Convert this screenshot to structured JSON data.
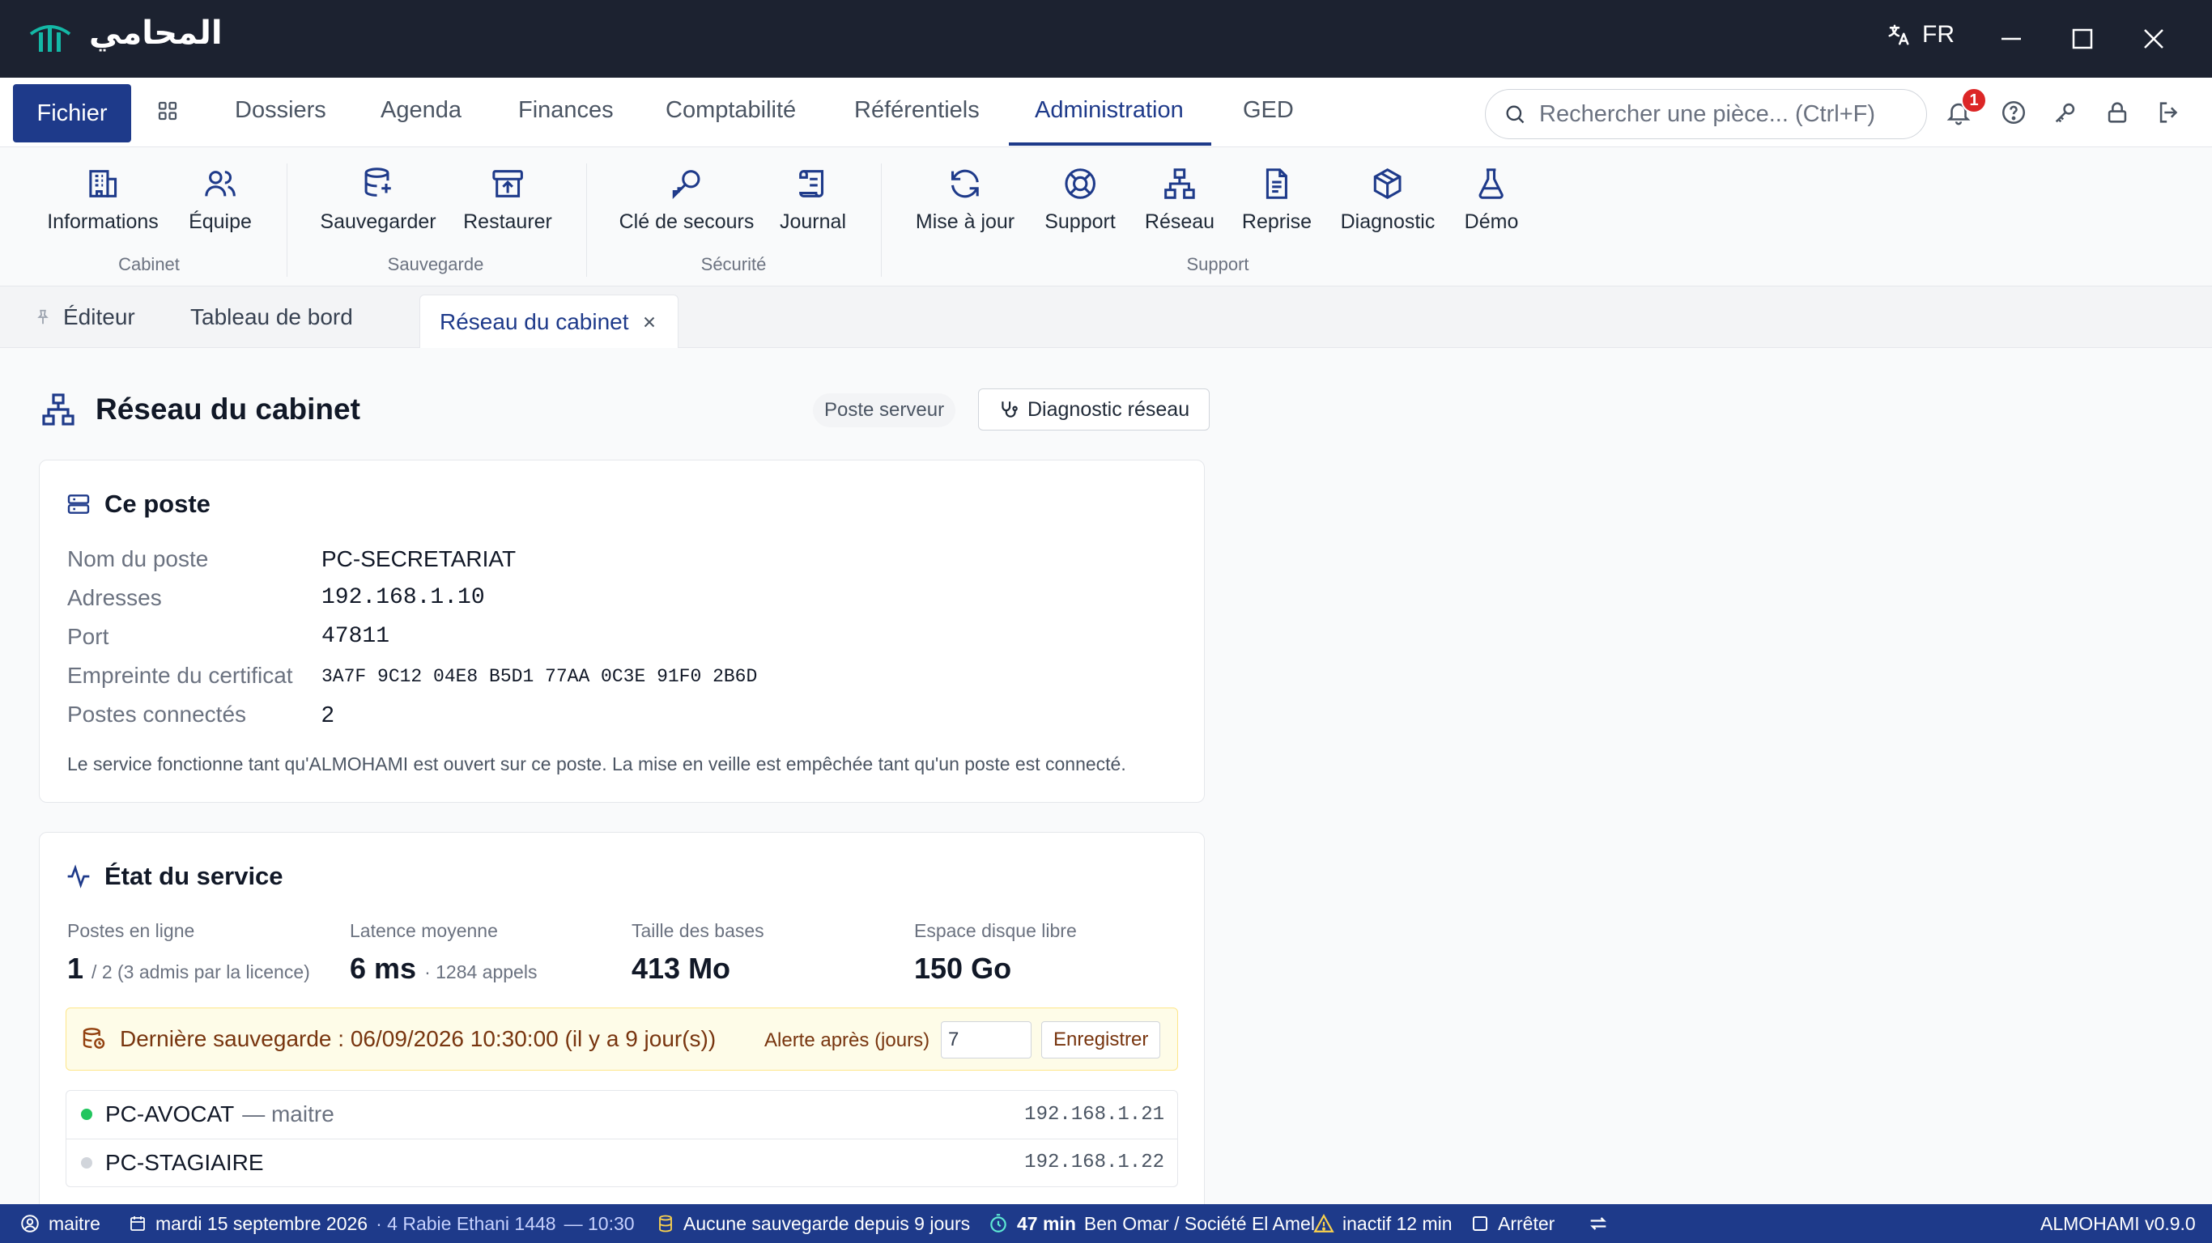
{
  "app": {
    "name": "المحامي",
    "language": "FR"
  },
  "menu": {
    "fichier": "Fichier",
    "items": [
      "Dossiers",
      "Agenda",
      "Finances",
      "Comptabilité",
      "Référentiels",
      "Administration",
      "GED"
    ],
    "active": "Administration",
    "search_placeholder": "Rechercher une pièce... (Ctrl+F)",
    "notification_count": "1"
  },
  "ribbon": {
    "buttons": [
      "Informations",
      "Équipe",
      "Sauvegarder",
      "Restaurer",
      "Clé de secours",
      "Journal",
      "Mise à jour",
      "Support",
      "Réseau",
      "Reprise",
      "Diagnostic",
      "Démo"
    ],
    "groups": [
      "Cabinet",
      "Sauvegarde",
      "Sécurité",
      "Support"
    ]
  },
  "tabs": {
    "editor": "Éditeur",
    "dashboard": "Tableau de bord",
    "active": "Réseau du cabinet"
  },
  "page": {
    "title": "Réseau du cabinet",
    "chip": "Poste serveur",
    "diagnostic_button": "Diagnostic réseau"
  },
  "this_station": {
    "title": "Ce poste",
    "labels": [
      "Nom du poste",
      "Adresses",
      "Port",
      "Empreinte du certificat",
      "Postes connectés"
    ],
    "name": "PC-SECRETARIAT",
    "address": "192.168.1.10",
    "port": "47811",
    "fingerprint": "3A7F 9C12 04E8 B5D1 77AA 0C3E 91F0 2B6D",
    "connected": "2",
    "note": "Le service fonctionne tant qu'ALMOHAMI est ouvert sur ce poste. La mise en veille est empêchée tant qu'un poste est connecté."
  },
  "service": {
    "title": "État du service",
    "online_label": "Postes en ligne",
    "online_value": "1",
    "online_detail": "/ 2 (3 admis par la licence)",
    "latency_label": "Latence moyenne",
    "latency_value": "6 ms",
    "latency_detail": "· 1284 appels",
    "db_label": "Taille des bases",
    "db_value": "413 Mo",
    "disk_label": "Espace disque libre",
    "disk_value": "150 Go",
    "backup_text": "Dernière sauvegarde : 06/09/2026 10:30:00 (il y a 9 jour(s))",
    "alert_label": "Alerte après (jours)",
    "alert_days": "7",
    "save_button": "Enregistrer",
    "peers": [
      {
        "name": "PC-AVOCAT",
        "role": "— maitre",
        "ip": "192.168.1.21",
        "status_color": "#22c55e"
      },
      {
        "name": "PC-STAGIAIRE",
        "role": "",
        "ip": "192.168.1.22",
        "status_color": "#d1d5db"
      }
    ]
  },
  "statusbar": {
    "user": "maitre",
    "date": "mardi 15 septembre 2026",
    "hijri": "· 4 Rabie Ethani 1448",
    "time": "— 10:30",
    "backup_warning": "Aucune sauvegarde depuis 9 jours",
    "timer": "47 min",
    "client": "Ben Omar / Société El Amel",
    "inactive": "inactif 12 min",
    "stop": "Arrêter",
    "version": "ALMOHAMI v0.9.0"
  },
  "colors": {
    "primary": "#1e3a8a",
    "titlebar": "#1c2230",
    "logo_teal": "#14b8a6",
    "warning": "#fcd34d"
  }
}
